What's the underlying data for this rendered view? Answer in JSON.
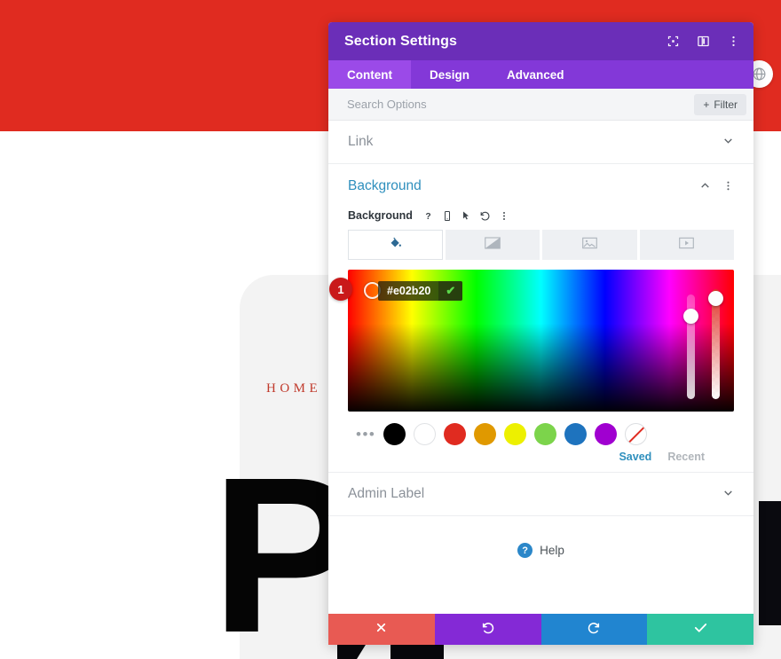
{
  "website": {
    "hero_color": "#e02b20",
    "nav_item": "HOME",
    "big_letter": "P",
    "globe_icon": "globe-icon"
  },
  "modal": {
    "title": "Section Settings",
    "titlebar_icons": [
      {
        "name": "expand-icon",
        "label": "Expand"
      },
      {
        "name": "layout-panel-icon",
        "label": "Layout"
      },
      {
        "name": "more-vertical-icon",
        "label": "More"
      }
    ],
    "tabs": [
      {
        "label": "Content",
        "active": true
      },
      {
        "label": "Design",
        "active": false
      },
      {
        "label": "Advanced",
        "active": false
      }
    ],
    "search": {
      "placeholder": "Search Options",
      "value": "",
      "filter_label": "Filter",
      "filter_icon": "plus-icon"
    },
    "sections": [
      {
        "label": "Link",
        "expanded": false
      },
      {
        "label": "Background",
        "expanded": true
      },
      {
        "label": "Admin Label",
        "expanded": false
      }
    ],
    "background": {
      "heading": "Background",
      "heading_color": "#2e8fbd",
      "collapse_icon": "chevron-up-icon",
      "options_icon": "more-vertical-icon",
      "field_label": "Background",
      "field_icons": [
        {
          "name": "help-question-icon",
          "glyph": "?"
        },
        {
          "name": "mobile-device-icon",
          "glyph": "mobile"
        },
        {
          "name": "cursor-hover-icon",
          "glyph": "cursor"
        },
        {
          "name": "reset-undo-icon",
          "glyph": "reset"
        },
        {
          "name": "more-vertical-icon",
          "glyph": "dots"
        }
      ],
      "type_tabs": [
        {
          "name": "background-color-tab",
          "icon": "paint-bucket-icon",
          "active": true
        },
        {
          "name": "background-gradient-tab",
          "icon": "gradient-icon",
          "active": false
        },
        {
          "name": "background-image-tab",
          "icon": "image-icon",
          "active": false
        },
        {
          "name": "background-video-tab",
          "icon": "video-icon",
          "active": false
        }
      ],
      "picker": {
        "hex_value": "#e02b20",
        "confirm_icon": "check-icon",
        "step_badge": "1",
        "step_badge_color": "#c9191a"
      },
      "swatches": [
        {
          "name": "swatch-black",
          "color": "#000000"
        },
        {
          "name": "swatch-white",
          "color": "#ffffff"
        },
        {
          "name": "swatch-red",
          "color": "#e02b20"
        },
        {
          "name": "swatch-orange",
          "color": "#e09900"
        },
        {
          "name": "swatch-yellow",
          "color": "#edf000"
        },
        {
          "name": "swatch-green",
          "color": "#7cd44b"
        },
        {
          "name": "swatch-blue",
          "color": "#1e73be"
        },
        {
          "name": "swatch-purple",
          "color": "#a000d0"
        },
        {
          "name": "swatch-transparent",
          "color": "transparent"
        }
      ],
      "more_swatches_label": "•••",
      "palette_tabs": [
        {
          "label": "Saved",
          "active": true
        },
        {
          "label": "Recent",
          "active": false
        }
      ]
    },
    "help": {
      "label": "Help",
      "icon": "help-question-icon"
    },
    "footer_actions": [
      {
        "name": "cancel-button",
        "icon": "close-x-icon",
        "color": "#e85a53"
      },
      {
        "name": "undo-button",
        "icon": "undo-icon",
        "color": "#8429d6"
      },
      {
        "name": "redo-button",
        "icon": "redo-icon",
        "color": "#2185d0"
      },
      {
        "name": "save-button",
        "icon": "check-icon",
        "color": "#2ec4a0"
      }
    ]
  }
}
